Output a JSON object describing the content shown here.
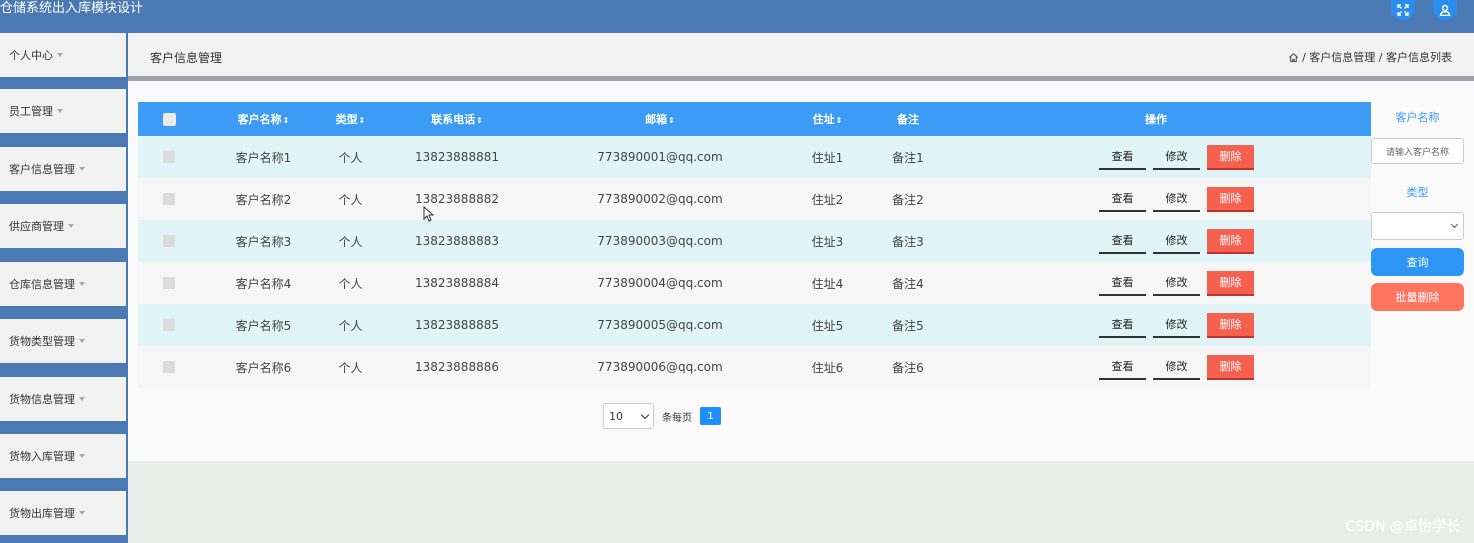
{
  "app": {
    "title": "仓储系统出入库模块设计"
  },
  "sidebar": {
    "items": [
      {
        "label": "个人中心"
      },
      {
        "label": "员工管理"
      },
      {
        "label": "客户信息管理"
      },
      {
        "label": "供应商管理"
      },
      {
        "label": "仓库信息管理"
      },
      {
        "label": "货物类型管理"
      },
      {
        "label": "货物信息管理"
      },
      {
        "label": "货物入库管理"
      },
      {
        "label": "货物出库管理"
      }
    ]
  },
  "breadcrumb": {
    "page_title": "客户信息管理",
    "path": "/ 客户信息管理 / 客户信息列表"
  },
  "table": {
    "headers": {
      "name": "客户名称",
      "type": "类型",
      "phone": "联系电话",
      "email": "邮箱",
      "address": "住址",
      "note": "备注",
      "ops": "操作"
    },
    "sort_glyph": "⇕",
    "rows": [
      {
        "name": "客户名称1",
        "type": "个人",
        "phone": "13823888881",
        "email": "773890001@qq.com",
        "address": "住址1",
        "note": "备注1"
      },
      {
        "name": "客户名称2",
        "type": "个人",
        "phone": "13823888882",
        "email": "773890002@qq.com",
        "address": "住址2",
        "note": "备注2"
      },
      {
        "name": "客户名称3",
        "type": "个人",
        "phone": "13823888883",
        "email": "773890003@qq.com",
        "address": "住址3",
        "note": "备注3"
      },
      {
        "name": "客户名称4",
        "type": "个人",
        "phone": "13823888884",
        "email": "773890004@qq.com",
        "address": "住址4",
        "note": "备注4"
      },
      {
        "name": "客户名称5",
        "type": "个人",
        "phone": "13823888885",
        "email": "773890005@qq.com",
        "address": "住址5",
        "note": "备注5"
      },
      {
        "name": "客户名称6",
        "type": "个人",
        "phone": "13823888886",
        "email": "773890006@qq.com",
        "address": "住址6",
        "note": "备注6"
      }
    ],
    "actions": {
      "view": "查看",
      "edit": "修改",
      "delete": "删除"
    }
  },
  "pagination": {
    "page_size": "10",
    "per_page_label": "条每页",
    "current_page": "1"
  },
  "filter": {
    "name_label": "客户名称",
    "name_placeholder": "请输入客户名称",
    "type_label": "类型",
    "type_value": "",
    "query_button": "查询",
    "batch_delete_button": "批量删除"
  },
  "watermark": "CSDN @卓怡学长",
  "colors": {
    "header_bar": "#4a79b4",
    "table_header": "#3c9cf5",
    "row_odd": "#e1f4f7",
    "row_even": "#f6f6f6",
    "delete_button": "#f5604f",
    "query_button": "#2d95f4",
    "batch_delete_button": "#ff7560"
  },
  "icons": [
    "fullscreen-icon",
    "user-icon",
    "home-icon",
    "sort-icon",
    "chevron-down-icon"
  ]
}
